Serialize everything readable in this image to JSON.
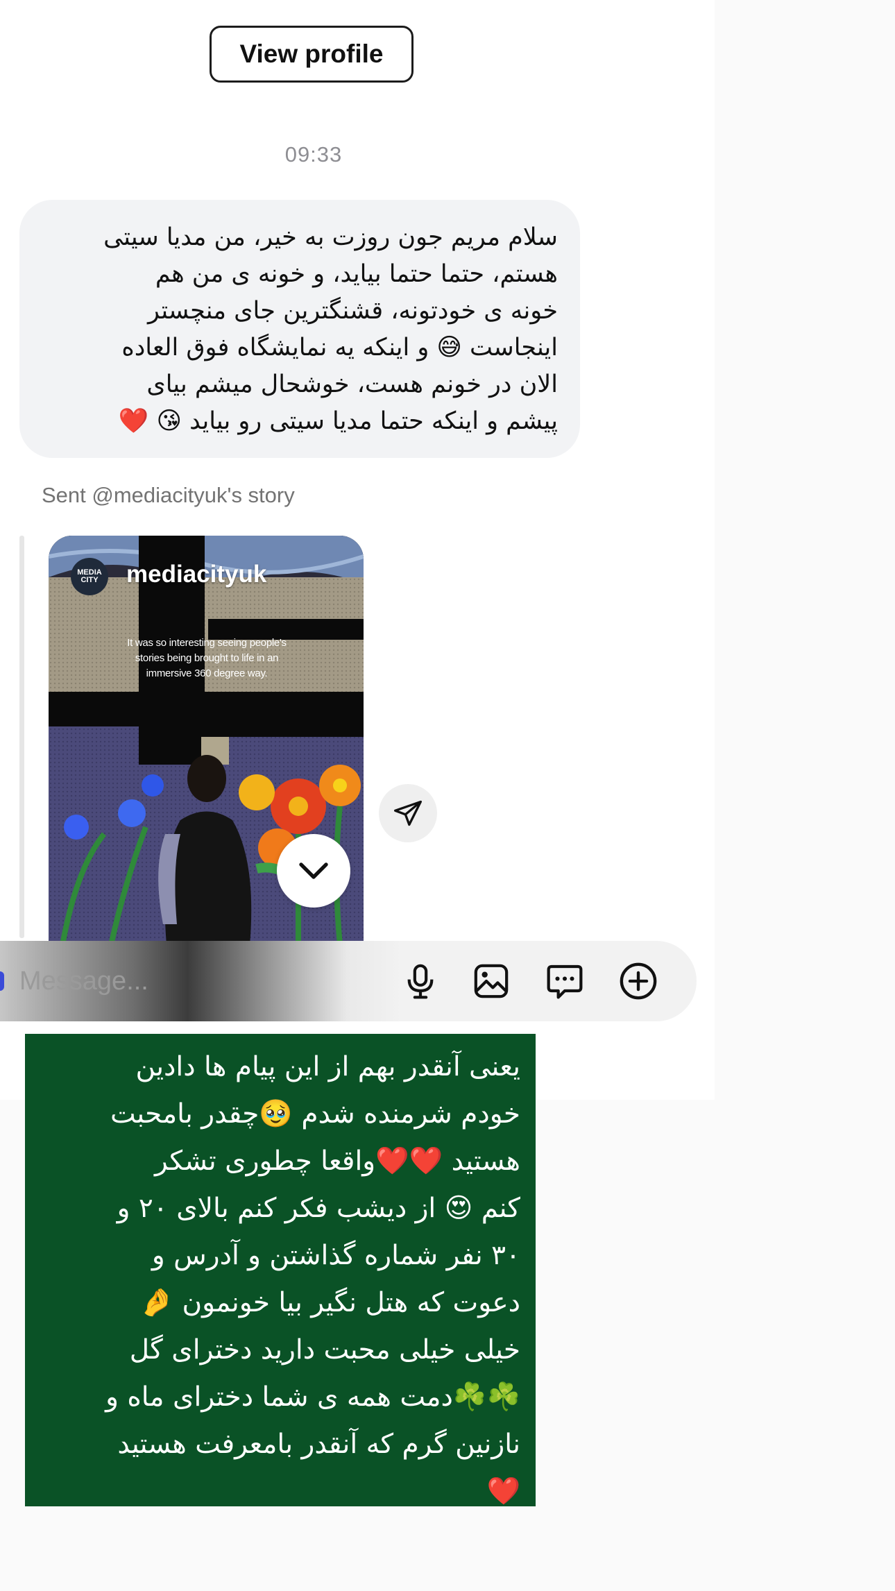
{
  "header": {
    "view_profile_label": "View profile"
  },
  "thread": {
    "timestamp": "09:33",
    "message_lines": [
      "سلام مریم جون روزت به خیر، من مدیا سیتی",
      "هستم،  حتما حتما بیاید، و خونه ی من هم",
      "خونه ی خودتونه، قشنگترین جای منچستر",
      "اینجاست 😅 و اینکه یه نمایشگاه فوق العاده",
      "الان در خونم هست، خوشحال میشم بیای",
      "پیشم و اینکه حتما مدیا سیتی رو بیاید 😘 ❤️"
    ],
    "story_label": "Sent @mediacityuk's story",
    "story": {
      "username": "mediacityuk",
      "avatar_text": "MEDIA CITY",
      "caption": "It was so interesting seeing people's stories being brought to life in an immersive 360 degree way."
    }
  },
  "composer": {
    "placeholder": "Message...",
    "icons": [
      "microphone-icon",
      "image-icon",
      "sticker-chat-icon",
      "plus-circle-icon"
    ]
  },
  "note_lines": [
    "یعنی آنقدر بهم از این پیام ها دادین",
    "خودم شرمنده شدم 🥹چقدر بامحبت",
    "هستید ❤️❤️واقعا چطوری تشکر",
    "کنم 😍 از دیشب فکر کنم بالای ۲۰ و",
    "۳۰ نفر شماره گذاشتن و آدرس و",
    "دعوت که هتل نگیر بیا خونمون 🤌",
    "خیلی خیلی محبت دارید دخترای گل",
    "☘️☘️دمت همه ی شما دخترای ماه و",
    "نازنین گرم که آنقدر بامعرفت هستید",
    "❤️"
  ],
  "colors": {
    "bubble_bg": "#f2f3f5",
    "note_bg": "#0a5226",
    "timestamp": "#8e8e93"
  }
}
